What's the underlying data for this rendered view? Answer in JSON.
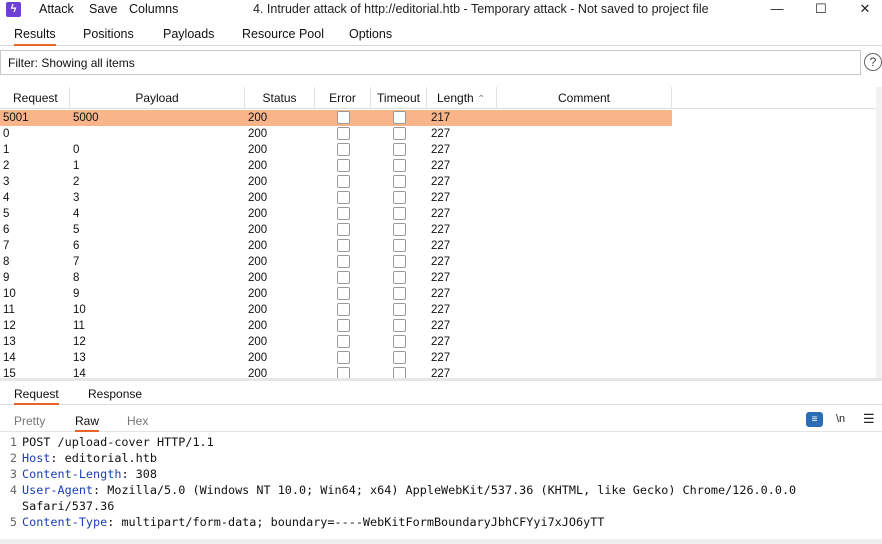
{
  "titlebar": {
    "menu": [
      "Attack",
      "Save",
      "Columns"
    ],
    "title": "4. Intruder attack of http://editorial.htb - Temporary attack - Not saved to project file"
  },
  "tabs": [
    "Results",
    "Positions",
    "Payloads",
    "Resource Pool",
    "Options"
  ],
  "filter": {
    "text": "Filter: Showing all items"
  },
  "table": {
    "columns": [
      "Request",
      "Payload",
      "Status",
      "Error",
      "Timeout",
      "Length",
      "Comment"
    ],
    "rows": [
      {
        "request": "5001",
        "payload": "5000",
        "status": "200",
        "length": "217"
      },
      {
        "request": "0",
        "payload": "",
        "status": "200",
        "length": "227"
      },
      {
        "request": "1",
        "payload": "0",
        "status": "200",
        "length": "227"
      },
      {
        "request": "2",
        "payload": "1",
        "status": "200",
        "length": "227"
      },
      {
        "request": "3",
        "payload": "2",
        "status": "200",
        "length": "227"
      },
      {
        "request": "4",
        "payload": "3",
        "status": "200",
        "length": "227"
      },
      {
        "request": "5",
        "payload": "4",
        "status": "200",
        "length": "227"
      },
      {
        "request": "6",
        "payload": "5",
        "status": "200",
        "length": "227"
      },
      {
        "request": "7",
        "payload": "6",
        "status": "200",
        "length": "227"
      },
      {
        "request": "8",
        "payload": "7",
        "status": "200",
        "length": "227"
      },
      {
        "request": "9",
        "payload": "8",
        "status": "200",
        "length": "227"
      },
      {
        "request": "10",
        "payload": "9",
        "status": "200",
        "length": "227"
      },
      {
        "request": "11",
        "payload": "10",
        "status": "200",
        "length": "227"
      },
      {
        "request": "12",
        "payload": "11",
        "status": "200",
        "length": "227"
      },
      {
        "request": "13",
        "payload": "12",
        "status": "200",
        "length": "227"
      },
      {
        "request": "14",
        "payload": "13",
        "status": "200",
        "length": "227"
      },
      {
        "request": "15",
        "payload": "14",
        "status": "200",
        "length": "227"
      }
    ]
  },
  "subtabs": [
    "Request",
    "Response"
  ],
  "viewtabs": [
    "Pretty",
    "Raw",
    "Hex"
  ],
  "editor_toolbar": {
    "newline_label": "\\n"
  },
  "editor": {
    "lines": [
      {
        "num": "1",
        "key": "",
        "value": "POST /upload-cover HTTP/1.1"
      },
      {
        "num": "2",
        "key": "Host",
        "value": ": editorial.htb"
      },
      {
        "num": "3",
        "key": "Content-Length",
        "value": ": 308"
      },
      {
        "num": "4",
        "key": "User-Agent",
        "value": ": Mozilla/5.0 (Windows NT 10.0; Win64; x64) AppleWebKit/537.36 (KHTML, like Gecko) Chrome/126.0.0.0"
      },
      {
        "num": "",
        "key": "",
        "value": "Safari/537.36"
      },
      {
        "num": "5",
        "key": "Content-Type",
        "value": ": multipart/form-data; boundary=----WebKitFormBoundaryJbhCFYyi7xJO6yTT"
      }
    ]
  },
  "colors": {
    "accent": "#e8662a",
    "selected_row": "#f9b48a",
    "header_key": "#1a3fb7",
    "app_icon": "#6c3fd6"
  }
}
